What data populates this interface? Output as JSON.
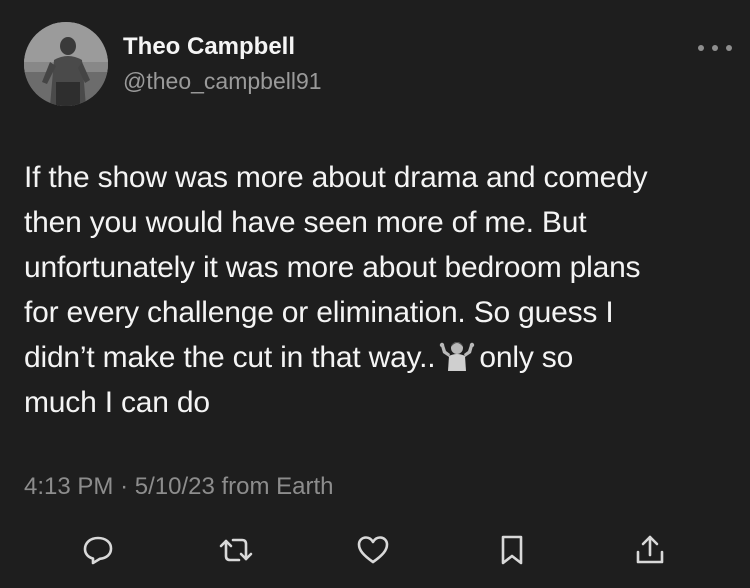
{
  "author": {
    "display_name": "Theo Campbell",
    "handle": "@theo_campbell91",
    "avatar_icon": "profile-photo"
  },
  "tweet": {
    "lines": [
      "If the show was more about drama and comedy",
      "then you would have seen more of me. But",
      "unfortunately it was more about bedroom plans",
      "for every challenge or elimination. So guess I",
      "didn’t make the cut in that way..",
      "only so",
      "much I can do"
    ],
    "emoji": "person-shrugging-emoji"
  },
  "meta": {
    "time": "4:13 PM",
    "separator": "·",
    "date": "5/10/23",
    "source": "from Earth"
  },
  "actions": [
    {
      "name": "reply",
      "icon": "reply-icon"
    },
    {
      "name": "repost",
      "icon": "repost-icon"
    },
    {
      "name": "like",
      "icon": "heart-icon"
    },
    {
      "name": "bookmark",
      "icon": "bookmark-icon"
    },
    {
      "name": "share",
      "icon": "share-icon"
    }
  ],
  "colors": {
    "background": "#1e1e1e",
    "text": "#f4f4f4",
    "muted": "#8d8d8d"
  }
}
